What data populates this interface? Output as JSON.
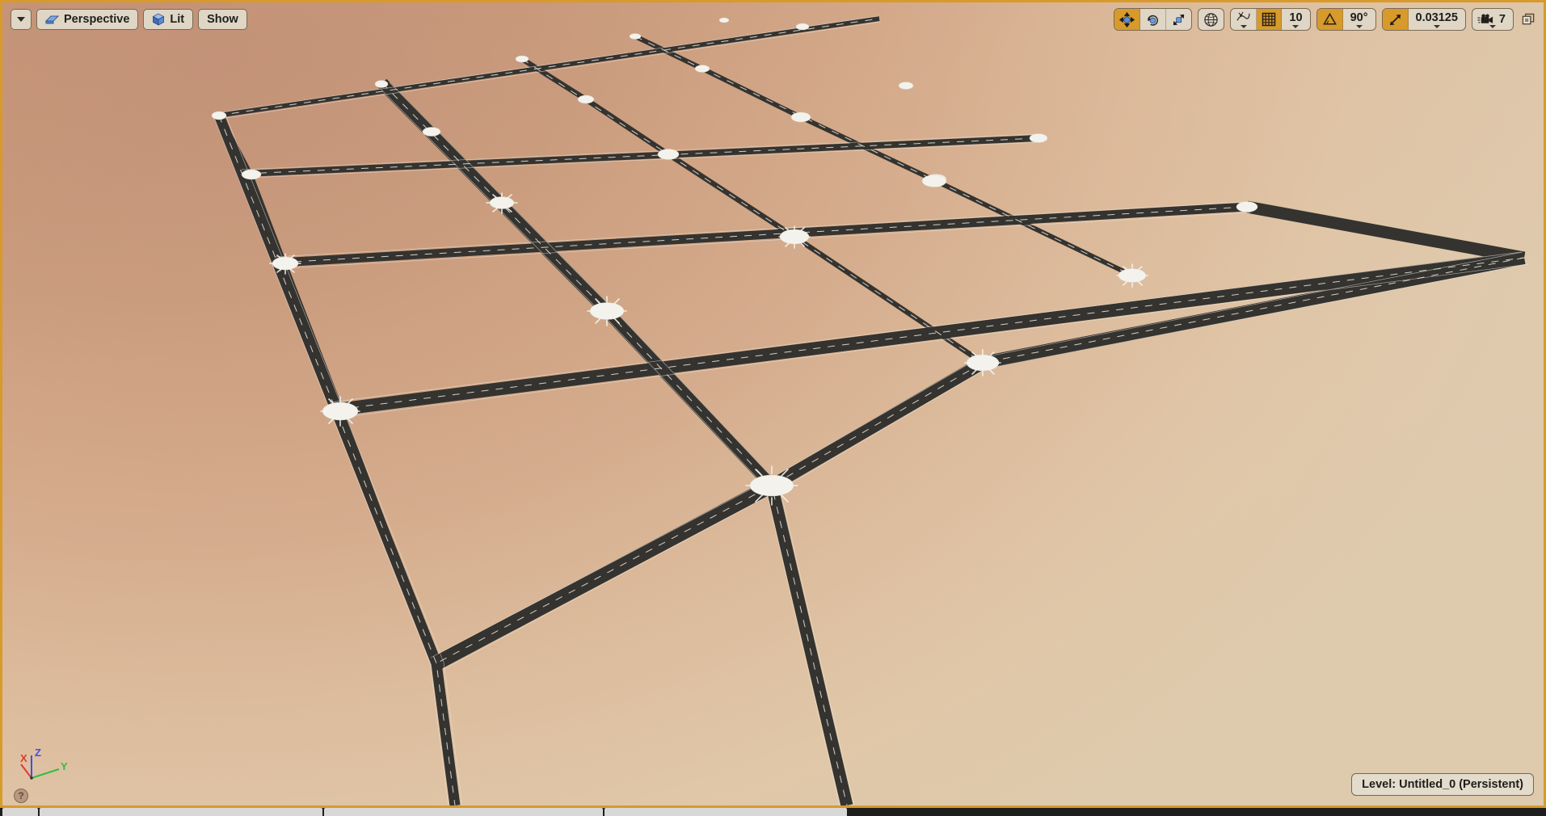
{
  "viewport": {
    "active_border_color": "#d79a2b",
    "scene_description": "Perspective 3D level viewport showing a procedurally generated road network grid on a tan ground plane",
    "ground_color_near": "#ddcba6",
    "ground_color_far": "#c2937a",
    "road_color": "#35332f",
    "road_marking_color": "#f2f0ea",
    "intersection_color": "#f4f2ec"
  },
  "toolbar_left": {
    "viewport_menu": {
      "icon": "chevron-down-icon",
      "label": ""
    },
    "camera_mode": {
      "icon": "camera-perspective-icon",
      "label": "Perspective"
    },
    "view_mode": {
      "icon": "lit-cube-icon",
      "label": "Lit"
    },
    "show_menu": {
      "label": "Show"
    }
  },
  "toolbar_right": {
    "transform_group": [
      {
        "name": "select-move-tool",
        "icon": "move-gizmo-icon",
        "active": true
      },
      {
        "name": "rotate-tool",
        "icon": "rotate-gizmo-icon",
        "active": false
      },
      {
        "name": "scale-tool",
        "icon": "scale-gizmo-icon",
        "active": false
      }
    ],
    "coordinate_system": {
      "icon": "globe-world-icon",
      "label": "World",
      "active": false
    },
    "surface_snap": {
      "icon": "surface-snap-icon",
      "active": false
    },
    "grid_snap": {
      "icon": "grid-snap-icon",
      "active": true,
      "value": "10"
    },
    "rotation_snap": {
      "icon": "angle-snap-icon",
      "active": true,
      "value": "90°"
    },
    "scale_snap": {
      "icon": "scale-snap-icon",
      "active": true,
      "value": "0.03125"
    },
    "camera_speed": {
      "icon": "camera-speed-icon",
      "value": "7"
    },
    "maximize": {
      "icon": "maximize-viewport-icon"
    }
  },
  "axis_gizmo": {
    "x_label": "X",
    "x_color": "#e03b2f",
    "y_label": "Y",
    "y_color": "#2fbf3f",
    "z_label": "Z",
    "z_color": "#3a4ff0"
  },
  "help": {
    "icon": "help-circle-icon",
    "label": "?"
  },
  "status": {
    "level_prefix": "Level:",
    "level_name": "Untitled_0 (Persistent)",
    "level_full": "Level:  Untitled_0 (Persistent)"
  }
}
